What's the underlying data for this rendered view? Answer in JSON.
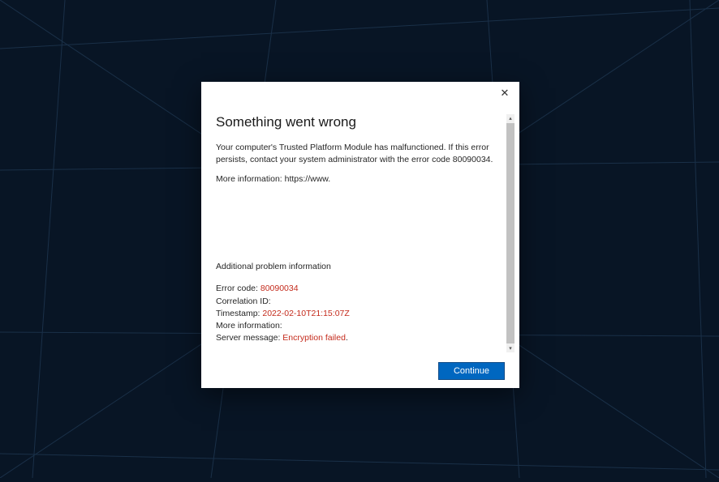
{
  "dialog": {
    "title": "Something went wrong",
    "description": "Your computer's Trusted Platform Module has malfunctioned. If this error persists, contact your system administrator with the error code 80090034.",
    "more_info_label": "More information: ",
    "more_info_link": "https://www.",
    "additional_header": "Additional problem information",
    "error_code_label": "Error code: ",
    "error_code_value": "80090034",
    "correlation_label": "Correlation ID:",
    "correlation_value": "",
    "timestamp_label": "Timestamp: ",
    "timestamp_value": "2022-02-10T21:15:07Z",
    "detail_more_info_label": "More information:",
    "detail_more_info_value": "",
    "server_msg_label": "Server message: ",
    "server_msg_value": "Encryption failed",
    "server_msg_suffix": ".",
    "continue_label": "Continue"
  }
}
